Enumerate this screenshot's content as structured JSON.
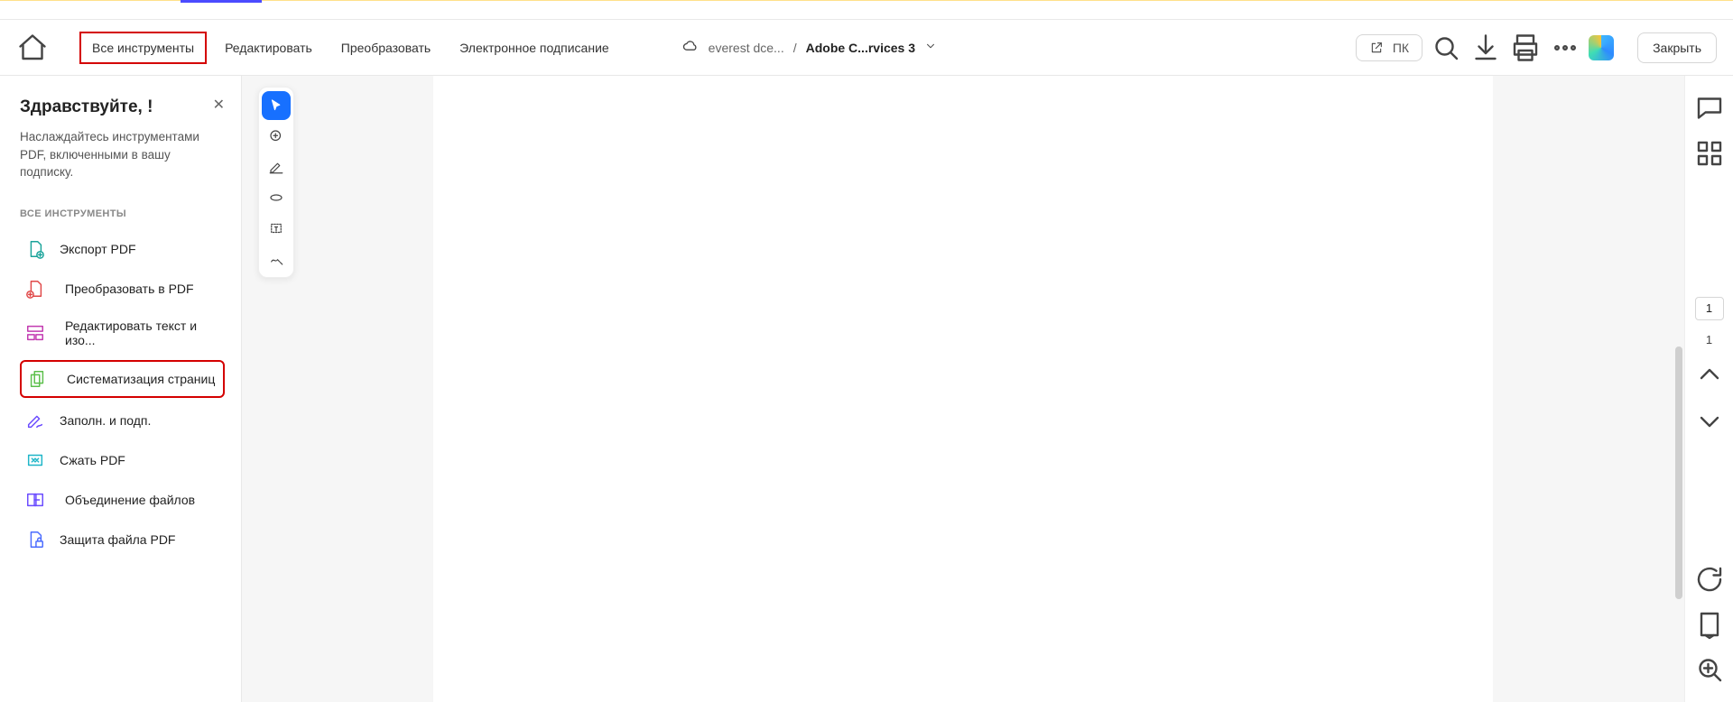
{
  "topbar": {
    "menu": [
      "Все инструменты",
      "Редактировать",
      "Преобразовать",
      "Электронное подписание"
    ],
    "cloud_label": "everest dce...",
    "doc_name": "Adobe C...rvices 3",
    "share_btn": "ПК",
    "close_label": "Закрыть"
  },
  "sidebar": {
    "greeting": "Здравствуйте, !",
    "subtext": "Наслаждайтесь инструментами PDF, включенными в вашу подписку.",
    "section": "ВСЕ ИНСТРУМЕНТЫ",
    "tools": [
      {
        "label": "Экспорт PDF"
      },
      {
        "label": "Преобразовать в PDF"
      },
      {
        "label": "Редактировать текст и изо..."
      },
      {
        "label": "Систематизация страниц"
      },
      {
        "label": "Заполн. и подп."
      },
      {
        "label": "Сжать PDF"
      },
      {
        "label": "Объединение файлов"
      },
      {
        "label": "Защита файла PDF"
      }
    ]
  },
  "pages": {
    "current": "1",
    "total": "1"
  }
}
